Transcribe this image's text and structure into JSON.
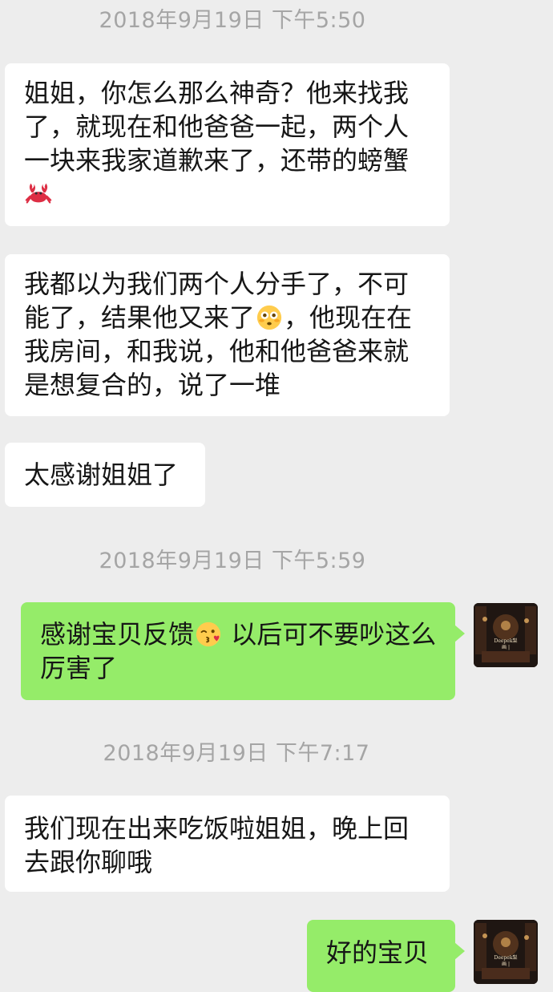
{
  "conversation": {
    "messages": [
      {
        "kind": "timestamp",
        "text": "2018年9月19日 下午5:50"
      },
      {
        "kind": "received",
        "text": "姐姐，你怎么那么神奇？他来找我了，就现在和他爸爸一起，两个人一块来我家道歉来了，还带的螃蟹",
        "emoji": "crab"
      },
      {
        "kind": "received",
        "text_before": "我都以为我们两个人分手了，不可能了，结果他又来了",
        "emoji": "flushed-face",
        "text_after": "，他现在在我房间，和我说，他和他爸爸来就是想复合的，说了一堆"
      },
      {
        "kind": "received",
        "text": "太感谢姐姐了"
      },
      {
        "kind": "timestamp",
        "text": "2018年9月19日 下午5:59"
      },
      {
        "kind": "sent",
        "text_before": "感谢宝贝反馈",
        "emoji": "kissing-face-wink",
        "text_after": " 以后可不要吵这么厉害了"
      },
      {
        "kind": "timestamp",
        "text": "2018年9月19日 下午7:17"
      },
      {
        "kind": "received",
        "text": "我们现在出来吃饭啦姐姐，晚上回去跟你聊哦"
      },
      {
        "kind": "sent",
        "text": "好的宝贝"
      }
    ]
  },
  "avatar": {
    "caption_line1": "Deepek梨 ",
    "caption_line2": "画 | "
  },
  "colors": {
    "background": "#ededed",
    "received_bubble": "#ffffff",
    "sent_bubble": "#95ec69",
    "timestamp_text": "#a5a5a5"
  }
}
